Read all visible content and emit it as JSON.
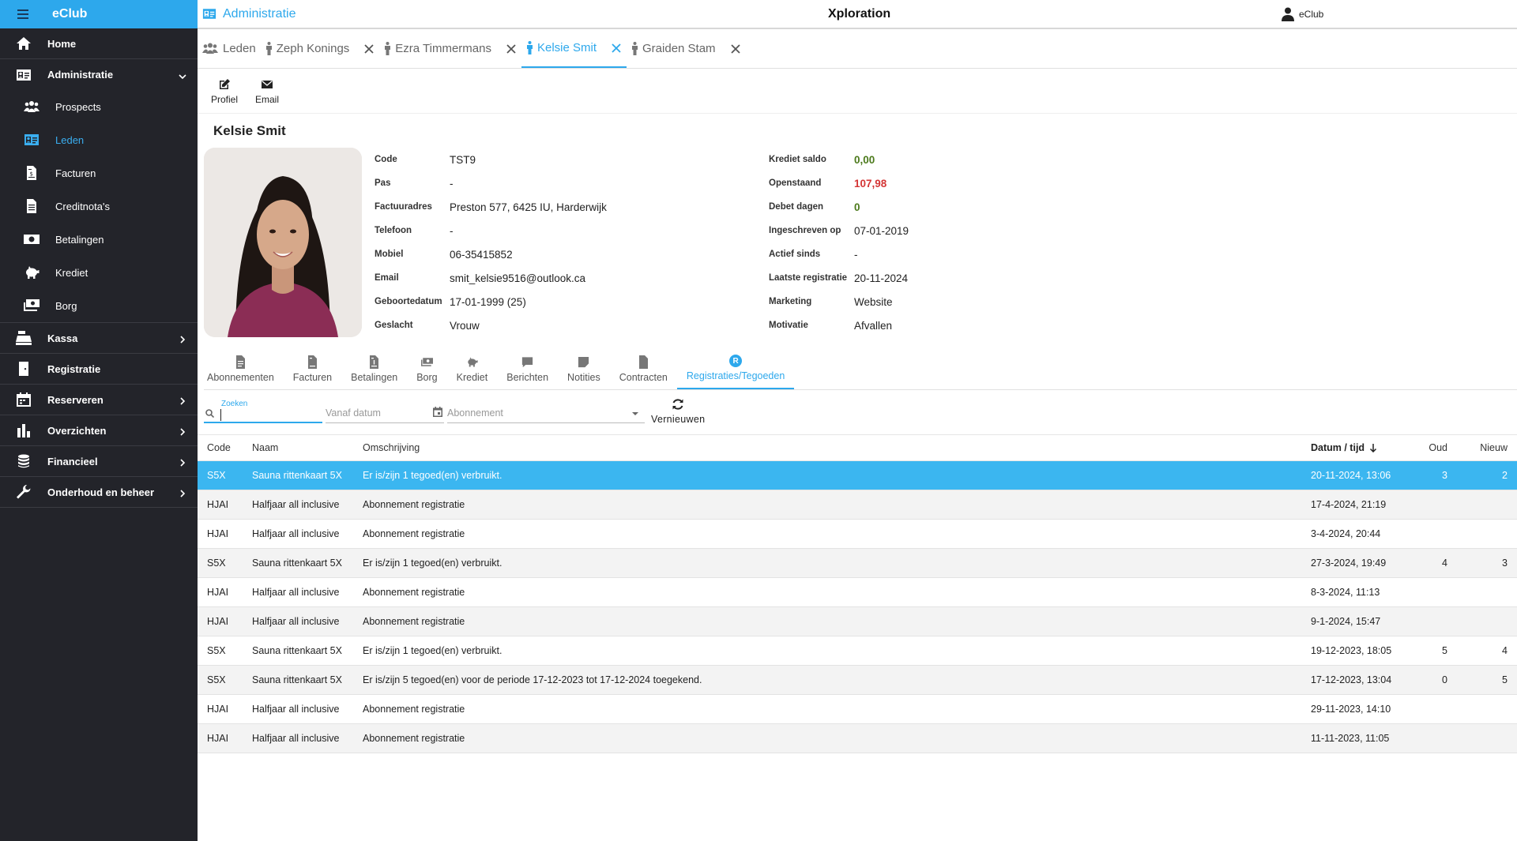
{
  "sidebar": {
    "brand": "eClub",
    "items": [
      {
        "label": "Home",
        "icon": "home-icon"
      },
      {
        "label": "Administratie",
        "icon": "id-card-icon",
        "expanded": true
      },
      {
        "label": "Kassa",
        "icon": "cash-register-icon"
      },
      {
        "label": "Registratie",
        "icon": "door-icon"
      },
      {
        "label": "Reserveren",
        "icon": "calendar-icon"
      },
      {
        "label": "Overzichten",
        "icon": "bar-chart-icon"
      },
      {
        "label": "Financieel",
        "icon": "coins-icon"
      },
      {
        "label": "Onderhoud en beheer",
        "icon": "wrench-icon"
      }
    ],
    "sub_items": [
      {
        "label": "Prospects",
        "icon": "people-icon"
      },
      {
        "label": "Leden",
        "icon": "id-card-icon",
        "active": true
      },
      {
        "label": "Facturen",
        "icon": "invoice-icon"
      },
      {
        "label": "Creditnota's",
        "icon": "credit-note-icon"
      },
      {
        "label": "Betalingen",
        "icon": "money-icon"
      },
      {
        "label": "Krediet",
        "icon": "piggy-bank-icon"
      },
      {
        "label": "Borg",
        "icon": "money-stack-icon"
      }
    ]
  },
  "topbar": {
    "section": "Administratie",
    "title": "Xploration",
    "user": "eClub"
  },
  "record_tabs": [
    {
      "label": "Leden",
      "icon": "group-icon",
      "closable": false
    },
    {
      "label": "Zeph Konings",
      "icon": "person-icon",
      "closable": true
    },
    {
      "label": "Ezra Timmermans",
      "icon": "person-icon",
      "closable": true
    },
    {
      "label": "Kelsie Smit",
      "icon": "person-icon",
      "closable": true,
      "active": true
    },
    {
      "label": "Graiden Stam",
      "icon": "person-icon",
      "closable": true
    }
  ],
  "actions": {
    "profile": "Profiel",
    "email": "Email"
  },
  "member": {
    "name": "Kelsie Smit",
    "left_fields": [
      {
        "label": "Code",
        "value": "TST9"
      },
      {
        "label": "Pas",
        "value": "-"
      },
      {
        "label": "Factuuradres",
        "value": "Preston 577, 6425 IU, Harderwijk"
      },
      {
        "label": "Telefoon",
        "value": "-"
      },
      {
        "label": "Mobiel",
        "value": "06-35415852"
      },
      {
        "label": "Email",
        "value": "smit_kelsie9516@outlook.ca"
      },
      {
        "label": "Geboortedatum",
        "value": "17-01-1999 (25)"
      },
      {
        "label": "Geslacht",
        "value": "Vrouw"
      }
    ],
    "right_fields": [
      {
        "label": "Krediet saldo",
        "value": "0,00",
        "color": "#4c7a1c"
      },
      {
        "label": "Openstaand",
        "value": "107,98",
        "color": "#d43636"
      },
      {
        "label": "Debet dagen",
        "value": "0",
        "color": "#4c7a1c"
      },
      {
        "label": "Ingeschreven op",
        "value": "07-01-2019"
      },
      {
        "label": "Actief sinds",
        "value": "-"
      },
      {
        "label": "Laatste registratie",
        "value": "20-11-2024"
      },
      {
        "label": "Marketing",
        "value": "Website"
      },
      {
        "label": "Motivatie",
        "value": "Afvallen"
      }
    ]
  },
  "subtabs": [
    {
      "label": "Abonnementen",
      "icon": "document-icon"
    },
    {
      "label": "Facturen",
      "icon": "invoice-icon"
    },
    {
      "label": "Betalingen",
      "icon": "invoice-dollar-icon"
    },
    {
      "label": "Borg",
      "icon": "money-stack-icon"
    },
    {
      "label": "Krediet",
      "icon": "piggy-bank-icon"
    },
    {
      "label": "Berichten",
      "icon": "message-icon"
    },
    {
      "label": "Notities",
      "icon": "note-icon"
    },
    {
      "label": "Contracten",
      "icon": "file-icon"
    },
    {
      "label": "Registraties/Tegoeden",
      "icon": "r-badge-icon",
      "badge": "R",
      "active": true
    }
  ],
  "filters": {
    "search_label": "Zoeken",
    "date_placeholder": "Vanaf datum",
    "subscription_placeholder": "Abonnement",
    "refresh": "Vernieuwen"
  },
  "table": {
    "headers": {
      "code": "Code",
      "naam": "Naam",
      "omschrijving": "Omschrijving",
      "datum": "Datum / tijd",
      "oud": "Oud",
      "nieuw": "Nieuw"
    },
    "rows": [
      {
        "code": "S5X",
        "naam": "Sauna rittenkaart 5X",
        "omschrijving": "Er is/zijn 1 tegoed(en) verbruikt.",
        "datum": "20-11-2024, 13:06",
        "oud": "3",
        "nieuw": "2",
        "selected": true
      },
      {
        "code": "HJAI",
        "naam": "Halfjaar all inclusive",
        "omschrijving": "Abonnement registratie",
        "datum": "17-4-2024, 21:19",
        "oud": "",
        "nieuw": ""
      },
      {
        "code": "HJAI",
        "naam": "Halfjaar all inclusive",
        "omschrijving": "Abonnement registratie",
        "datum": "3-4-2024, 20:44",
        "oud": "",
        "nieuw": ""
      },
      {
        "code": "S5X",
        "naam": "Sauna rittenkaart 5X",
        "omschrijving": "Er is/zijn 1 tegoed(en) verbruikt.",
        "datum": "27-3-2024, 19:49",
        "oud": "4",
        "nieuw": "3"
      },
      {
        "code": "HJAI",
        "naam": "Halfjaar all inclusive",
        "omschrijving": "Abonnement registratie",
        "datum": "8-3-2024, 11:13",
        "oud": "",
        "nieuw": ""
      },
      {
        "code": "HJAI",
        "naam": "Halfjaar all inclusive",
        "omschrijving": "Abonnement registratie",
        "datum": "9-1-2024, 15:47",
        "oud": "",
        "nieuw": ""
      },
      {
        "code": "S5X",
        "naam": "Sauna rittenkaart 5X",
        "omschrijving": "Er is/zijn 1 tegoed(en) verbruikt.",
        "datum": "19-12-2023, 18:05",
        "oud": "5",
        "nieuw": "4"
      },
      {
        "code": "S5X",
        "naam": "Sauna rittenkaart 5X",
        "omschrijving": "Er is/zijn 5 tegoed(en) voor de periode 17-12-2023 tot 17-12-2024 toegekend.",
        "datum": "17-12-2023, 13:04",
        "oud": "0",
        "nieuw": "5"
      },
      {
        "code": "HJAI",
        "naam": "Halfjaar all inclusive",
        "omschrijving": "Abonnement registratie",
        "datum": "29-11-2023, 14:10",
        "oud": "",
        "nieuw": ""
      },
      {
        "code": "HJAI",
        "naam": "Halfjaar all inclusive",
        "omschrijving": "Abonnement registratie",
        "datum": "11-11-2023, 11:05",
        "oud": "",
        "nieuw": ""
      }
    ]
  },
  "colors": {
    "accent": "#2da8ec",
    "sidebar_bg": "#23242a",
    "selected_row": "#3bb6f0",
    "positive": "#4c7a1c",
    "negative": "#d43636"
  }
}
